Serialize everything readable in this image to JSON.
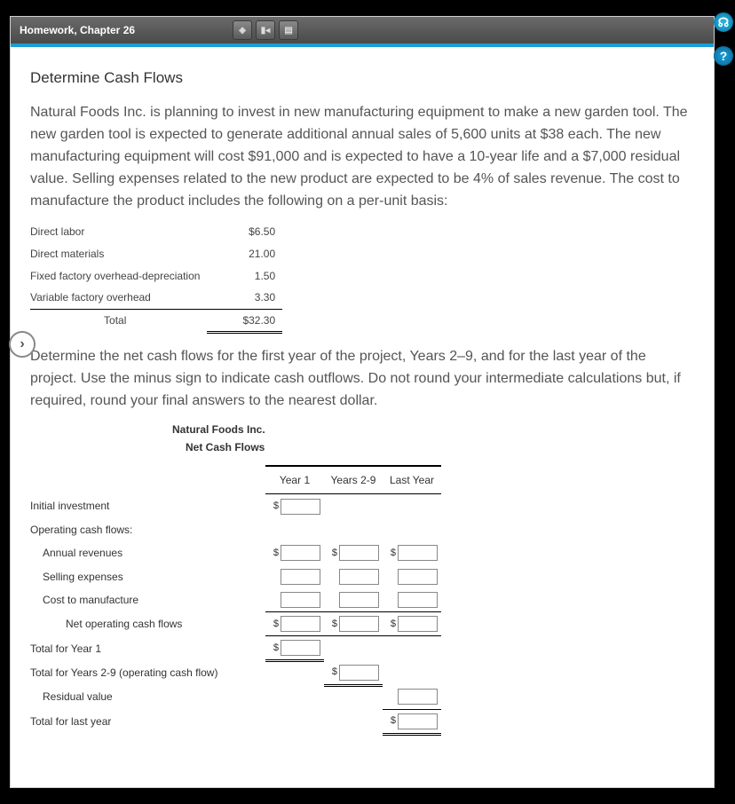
{
  "header": {
    "title": "Homework, Chapter 26"
  },
  "page": {
    "title": "Determine Cash Flows",
    "para1": "Natural Foods Inc. is planning to invest in new manufacturing equipment to make a new garden tool. The new garden tool is expected to generate additional annual sales of 5,600 units at $38 each. The new manufacturing equipment will cost $91,000 and is expected to have a 10-year life and a $7,000 residual value. Selling expenses related to the new product are expected to be 4% of sales revenue. The cost to manufacture the product includes the following on a per-unit basis:",
    "costs": {
      "rows": [
        {
          "label": "Direct labor",
          "value": "$6.50"
        },
        {
          "label": "Direct materials",
          "value": "21.00"
        },
        {
          "label": "Fixed factory overhead-depreciation",
          "value": "1.50"
        },
        {
          "label": "Variable factory overhead",
          "value": "3.30"
        }
      ],
      "total_label": "Total",
      "total_value": "$32.30"
    },
    "para2": "Determine the net cash flows for the first year of the project, Years 2–9, and for the last year of the project. Use the minus sign to indicate cash outflows. Do not round your intermediate calculations but, if required, round your final answers to the nearest dollar.",
    "wks_company": "Natural Foods Inc.",
    "wks_title": "Net Cash Flows",
    "cols": {
      "c1": "Year 1",
      "c2": "Years 2-9",
      "c3": "Last Year"
    },
    "rows": {
      "initial": "Initial investment",
      "ocf_head": "Operating cash flows:",
      "rev": "Annual revenues",
      "sell": "Selling expenses",
      "manu": "Cost to manufacture",
      "netop": "Net operating cash flows",
      "ty1": "Total for Year 1",
      "ty29": "Total for Years 2-9 (operating cash flow)",
      "resid": "Residual value",
      "tlast": "Total for last year"
    },
    "dollar": "$"
  }
}
